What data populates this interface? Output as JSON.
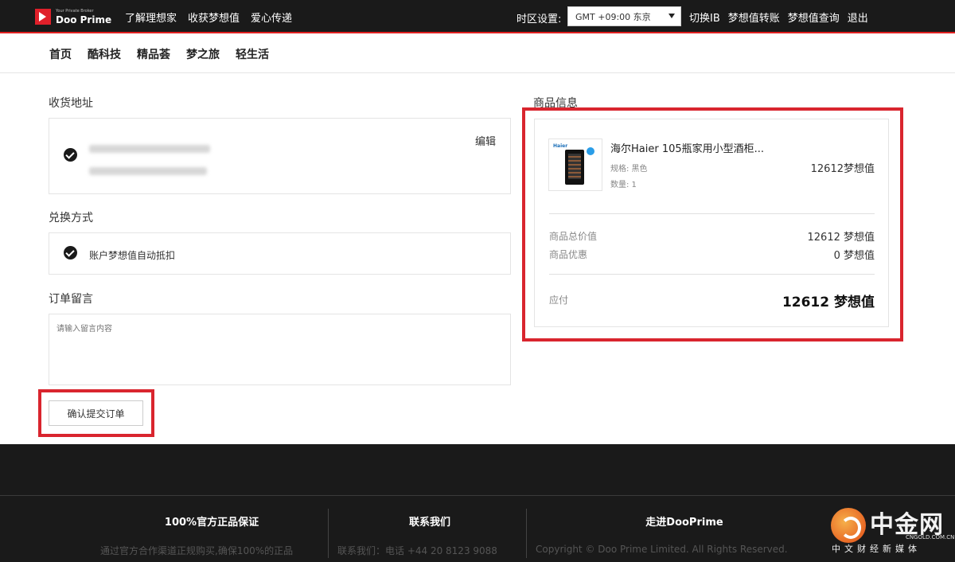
{
  "header": {
    "logo": {
      "tagline": "Your Private Broker",
      "name": "Doo Prime"
    },
    "nav_left": [
      "了解理想家",
      "收获梦想值",
      "爱心传递"
    ],
    "timezone_label": "时区设置:",
    "timezone_value": "GMT +09:00 东京",
    "nav_right": [
      "切换IB",
      "梦想值转账",
      "梦想值查询",
      "退出"
    ]
  },
  "category_nav": [
    "首页",
    "酷科技",
    "精品荟",
    "梦之旅",
    "轻生活"
  ],
  "address": {
    "title": "收货地址",
    "edit_label": "编辑"
  },
  "exchange": {
    "title": "兑换方式",
    "method": "账户梦想值自动抵扣"
  },
  "message": {
    "title": "订单留言",
    "placeholder": "请输入留言内容"
  },
  "submit_label": "确认提交订单",
  "product_info": {
    "title": "商品信息",
    "thumbnail_brand": "Haier",
    "name": "海尔Haier 105瓶家用小型酒柜...",
    "spec": "规格: 黑色",
    "quantity": "数量: 1",
    "price": "12612梦想值",
    "total_label": "商品总价值",
    "total_value": "12612 梦想值",
    "discount_label": "商品优惠",
    "discount_value": "0 梦想值",
    "payable_label": "应付",
    "payable_value": "12612 梦想值"
  },
  "footer": {
    "col1_title": "100%官方正品保证",
    "col1_text": "通过官方合作渠道正规购买,确保100%的正品",
    "col2_title": "联系我们",
    "col2_text": "联系我们：电话 +44 20 8123 9088",
    "col3_title": "走进DooPrime",
    "col3_text": "Copyright © Doo Prime Limited. All Rights Reserved."
  },
  "watermark": {
    "name": "中金网",
    "url": "CNGOLD.COM.CN",
    "slogan": "中文财经新媒体"
  },
  "colors": {
    "topbar": "#1a1a1a",
    "accent_red": "#d9252e",
    "footer": "#1a1a1a"
  }
}
